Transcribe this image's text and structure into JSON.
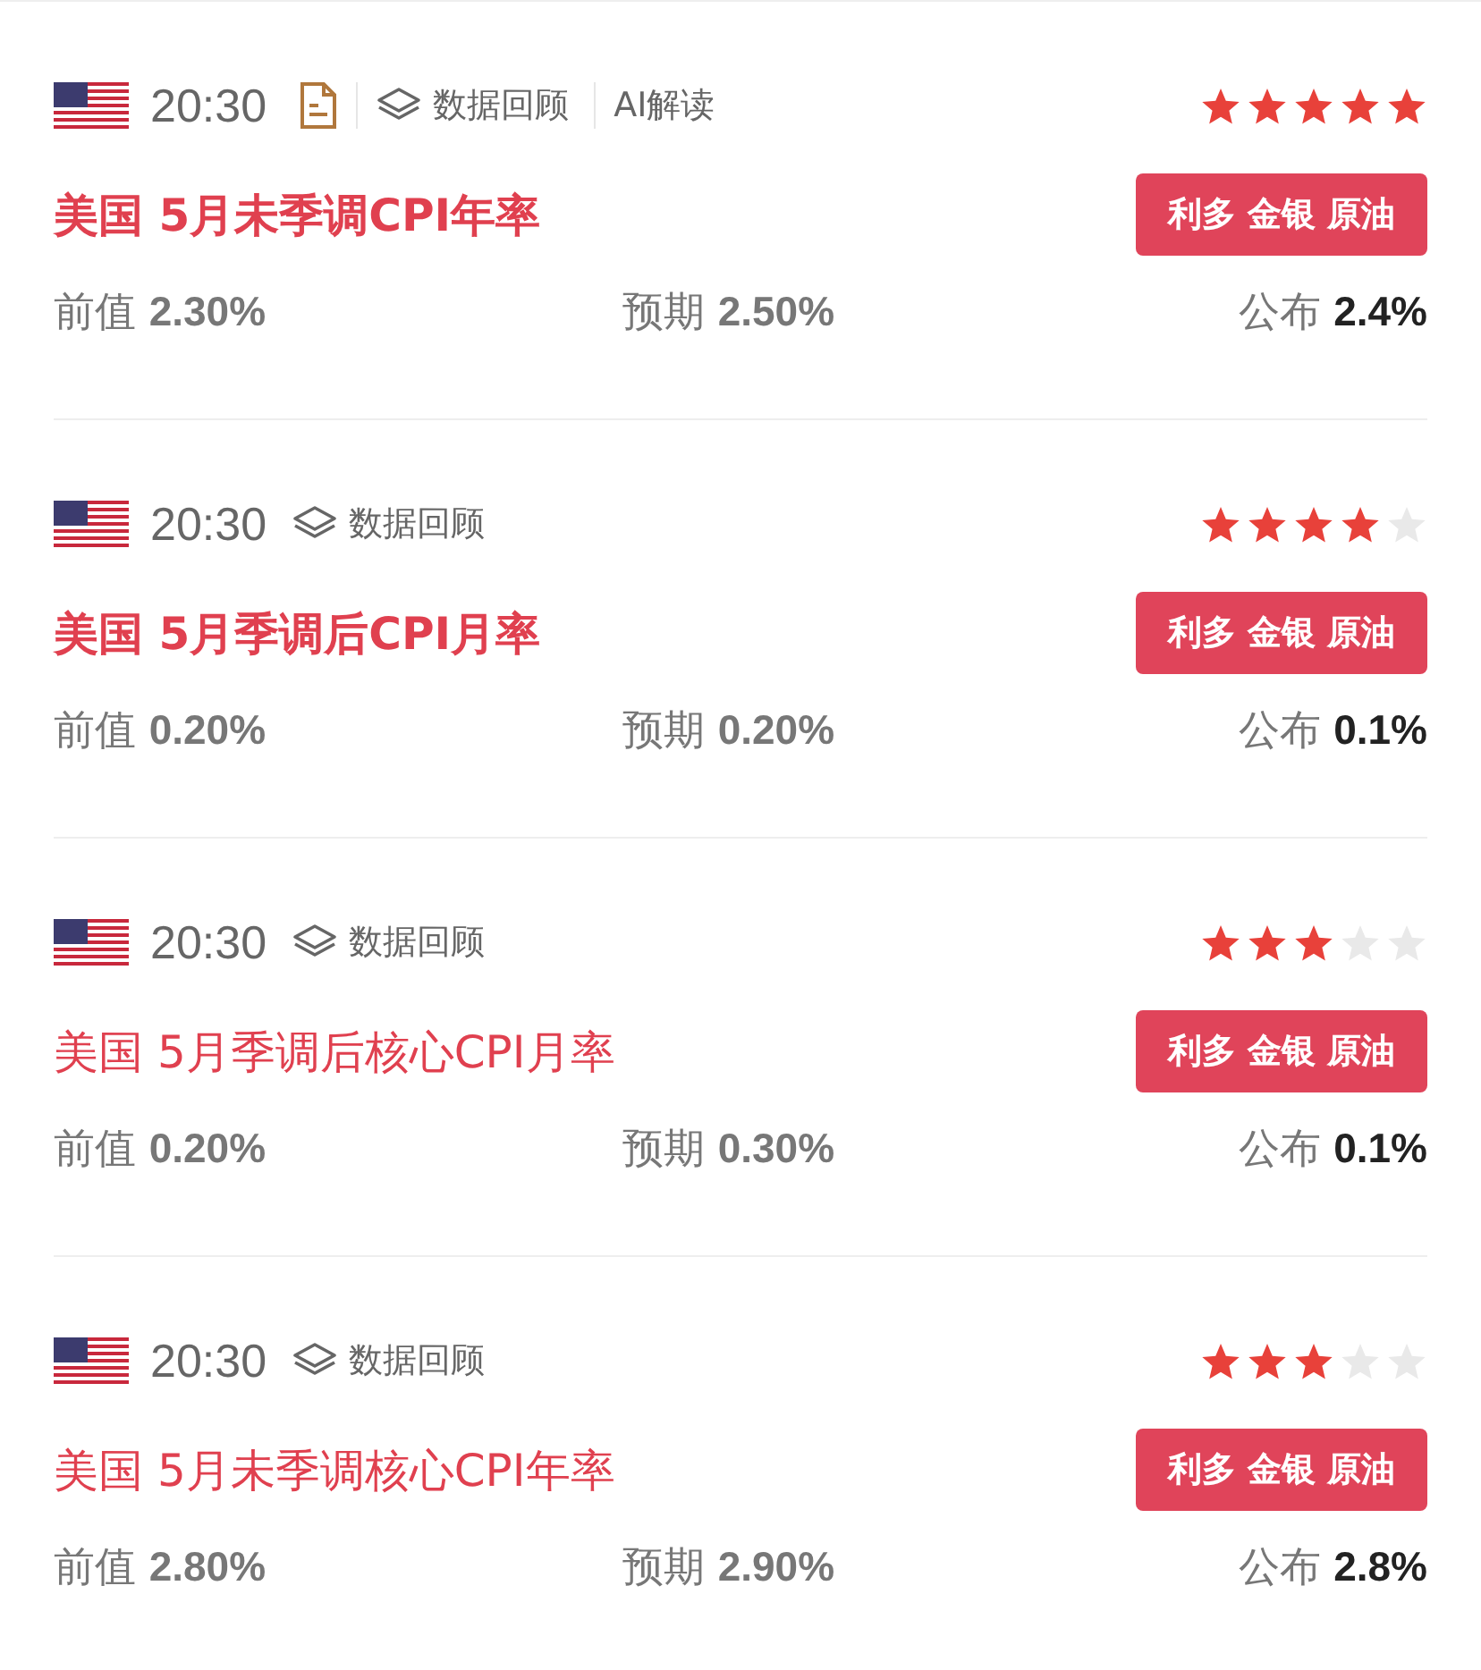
{
  "events": [
    {
      "time": "20:30",
      "tools": [
        {
          "kind": "doc"
        },
        {
          "kind": "review",
          "label": "数据回顾"
        },
        {
          "kind": "ai",
          "label": "AI解读"
        }
      ],
      "stars": 5,
      "title": "美国 5月未季调CPI年率",
      "emphasized": true,
      "tag": "利多 金银 原油",
      "previous_label": "前值",
      "previous": "2.30%",
      "forecast_label": "预期",
      "forecast": "2.50%",
      "actual_label": "公布",
      "actual": "2.4%"
    },
    {
      "time": "20:30",
      "tools": [
        {
          "kind": "review",
          "label": "数据回顾"
        }
      ],
      "stars": 4,
      "title": "美国 5月季调后CPI月率",
      "emphasized": true,
      "tag": "利多 金银 原油",
      "previous_label": "前值",
      "previous": "0.20%",
      "forecast_label": "预期",
      "forecast": "0.20%",
      "actual_label": "公布",
      "actual": "0.1%"
    },
    {
      "time": "20:30",
      "tools": [
        {
          "kind": "review",
          "label": "数据回顾"
        }
      ],
      "stars": 3,
      "title": "美国 5月季调后核心CPI月率",
      "emphasized": false,
      "tag": "利多 金银 原油",
      "previous_label": "前值",
      "previous": "0.20%",
      "forecast_label": "预期",
      "forecast": "0.30%",
      "actual_label": "公布",
      "actual": "0.1%"
    },
    {
      "time": "20:30",
      "tools": [
        {
          "kind": "review",
          "label": "数据回顾"
        }
      ],
      "stars": 3,
      "title": "美国 5月未季调核心CPI年率",
      "emphasized": false,
      "tag": "利多 金银 原油",
      "previous_label": "前值",
      "previous": "2.80%",
      "forecast_label": "预期",
      "forecast": "2.90%",
      "actual_label": "公布",
      "actual": "2.8%"
    }
  ]
}
